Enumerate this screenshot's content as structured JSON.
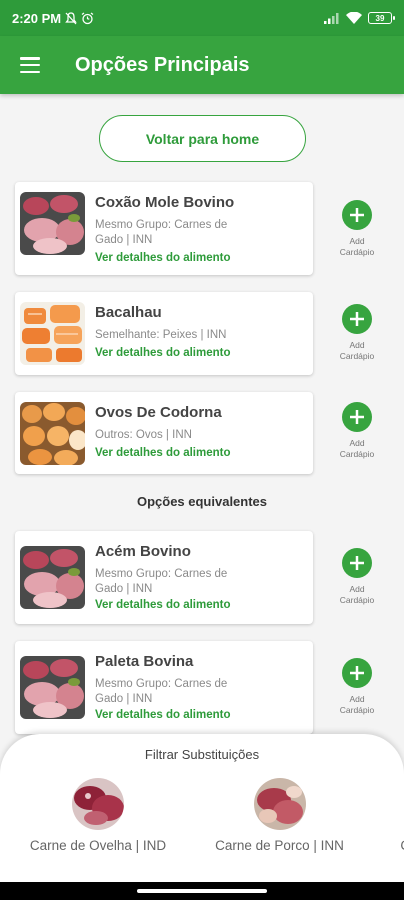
{
  "status_bar": {
    "time": "2:20 PM",
    "battery": "39"
  },
  "app_bar": {
    "title": "Opções Principais"
  },
  "home_button": {
    "label": "Voltar para home"
  },
  "main_options": [
    {
      "title": "Coxão Mole Bovino",
      "subtitle": "Mesmo Grupo: Carnes de Gado | INN",
      "link": "Ver detalhes do alimento",
      "add_label": "Add Cardápio",
      "image": "raw-beef"
    },
    {
      "title": "Bacalhau",
      "subtitle": "Semelhante: Peixes | INN",
      "link": "Ver detalhes do alimento",
      "add_label": "Add Cardápio",
      "image": "salmon-fillets"
    },
    {
      "title": "Ovos De Codorna",
      "subtitle": "Outros: Ovos | INN",
      "link": "Ver detalhes do alimento",
      "add_label": "Add Cardápio",
      "image": "eggs"
    }
  ],
  "equivalent_section": {
    "title": "Opções equivalentes"
  },
  "equivalent_options": [
    {
      "title": "Acém Bovino",
      "subtitle": "Mesmo Grupo: Carnes de Gado | INN",
      "link": "Ver detalhes do alimento",
      "add_label": "Add Cardápio",
      "image": "raw-beef"
    },
    {
      "title": "Paleta Bovina",
      "subtitle": "Mesmo Grupo: Carnes de Gado | INN",
      "link": "Ver detalhes do alimento",
      "add_label": "Add Cardápio",
      "image": "raw-beef"
    }
  ],
  "filter_sheet": {
    "title": "Filtrar Substituições",
    "items": [
      {
        "label": "Carne de Ovelha | IND",
        "image": "lamb-meat"
      },
      {
        "label": "Carne de Porco | INN",
        "image": "pork-meat"
      },
      {
        "label": "Ca",
        "image": "meat"
      }
    ]
  },
  "colors": {
    "primary": "#37a43f",
    "status_bar": "#2e9b3a",
    "link": "#2e9b3a"
  }
}
